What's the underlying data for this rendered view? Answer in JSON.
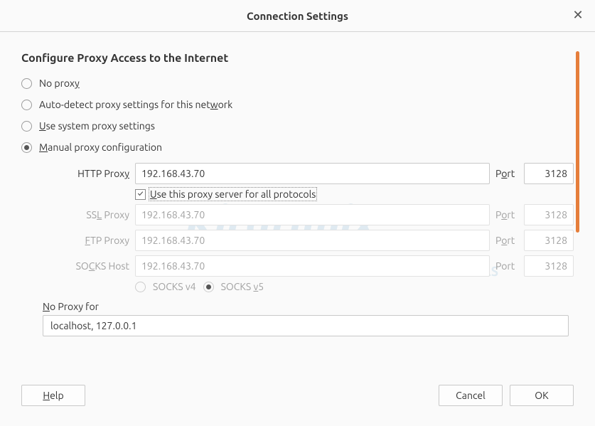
{
  "title": "Connection Settings",
  "sectionTitle": "Configure Proxy Access to the Internet",
  "radios": {
    "noProxy": "No prox",
    "noProxyU": "y",
    "autoDetect1": "Auto-detect proxy settings for this net",
    "autoDetectU": "w",
    "autoDetect2": "ork",
    "systemU": "U",
    "system": "se system proxy settings",
    "manualU": "M",
    "manual": "anual proxy configuration"
  },
  "fields": {
    "httpLabel": "HTTP Prox",
    "httpLabelU": "y",
    "httpValue": "192.168.43.70",
    "httpPortLabel": "P",
    "httpPortLabelU": "o",
    "httpPortLabel2": "rt",
    "httpPort": "3128",
    "useAllU": "U",
    "useAll": "se this proxy server for all protocols",
    "sslLabel": "SS",
    "sslLabelU": "L",
    "sslLabel2": " Proxy",
    "sslValue": "192.168.43.70",
    "sslPort": "3128",
    "ftpLabelU": "F",
    "ftpLabel": "TP Proxy",
    "ftpValue": "192.168.43.70",
    "ftpPort": "3128",
    "socksLabel": "SO",
    "socksLabelU": "C",
    "socksLabel2": "KS Host",
    "socksValue": "192.168.43.70",
    "socksPort": "3128",
    "portLabel": "Port",
    "portLabelU": "o",
    "socksV4": "SOCKS v4",
    "socksV5_1": "SOCKS ",
    "socksV5U": "v",
    "socksV5_2": "5",
    "noProxyForU": "N",
    "noProxyFor": "o Proxy for",
    "noProxyValue": "localhost, 127.0.0.1"
  },
  "buttons": {
    "helpU": "H",
    "help": "elp",
    "cancel": "Cancel",
    "ok": "OK"
  }
}
